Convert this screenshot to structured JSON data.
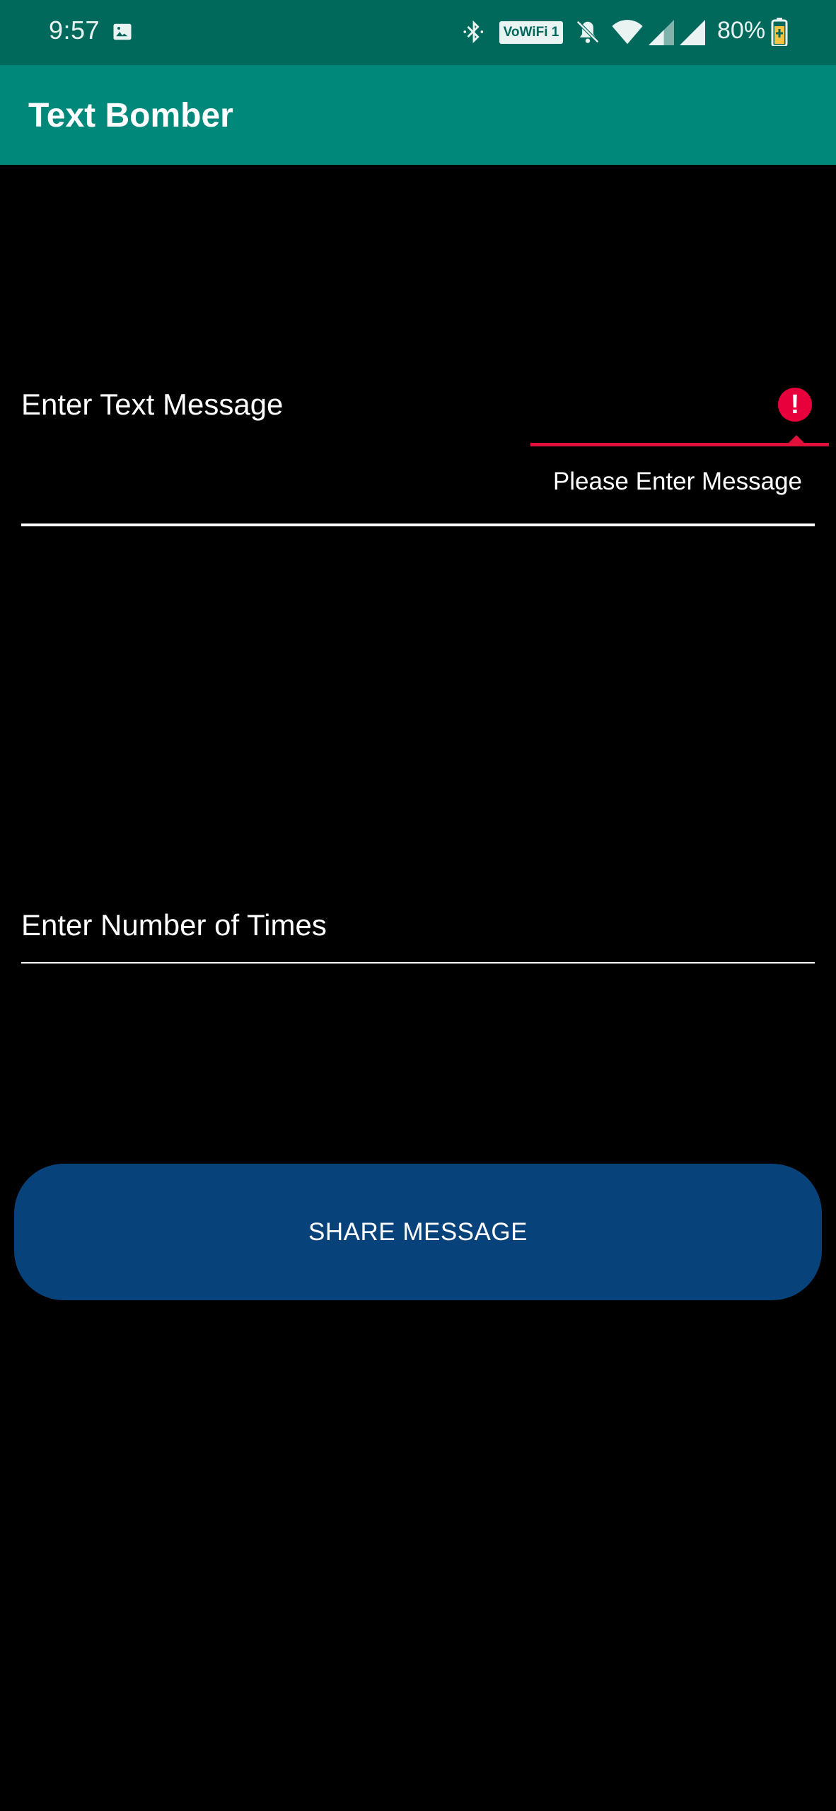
{
  "status_bar": {
    "time": "9:57",
    "volte_label": "VoWiFi 1",
    "battery": "80%"
  },
  "app_bar": {
    "title": "Text Bomber"
  },
  "message_field": {
    "placeholder": "Enter Text Message",
    "value": "",
    "error_text": "Please Enter Message"
  },
  "count_field": {
    "placeholder": "Enter Number of Times",
    "value": ""
  },
  "share_button": {
    "label": "SHARE MESSAGE"
  },
  "colors": {
    "status_bar": "#00695c",
    "app_bar": "#00897b",
    "error": "#e8003d",
    "button": "#08427a"
  }
}
